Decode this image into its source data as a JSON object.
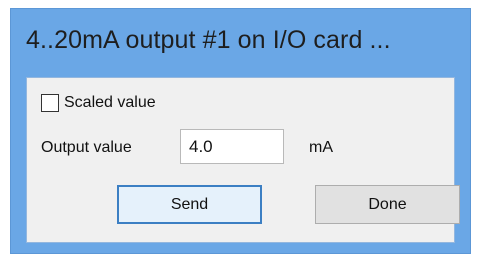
{
  "window": {
    "title": "4..20mA output #1 on I/O card ..."
  },
  "form": {
    "scaled_checkbox": {
      "label": "Scaled value",
      "checked": false
    },
    "output_label": "Output value",
    "output_value": "4.0",
    "unit": "mA"
  },
  "buttons": {
    "send_label": "Send",
    "done_label": "Done"
  }
}
